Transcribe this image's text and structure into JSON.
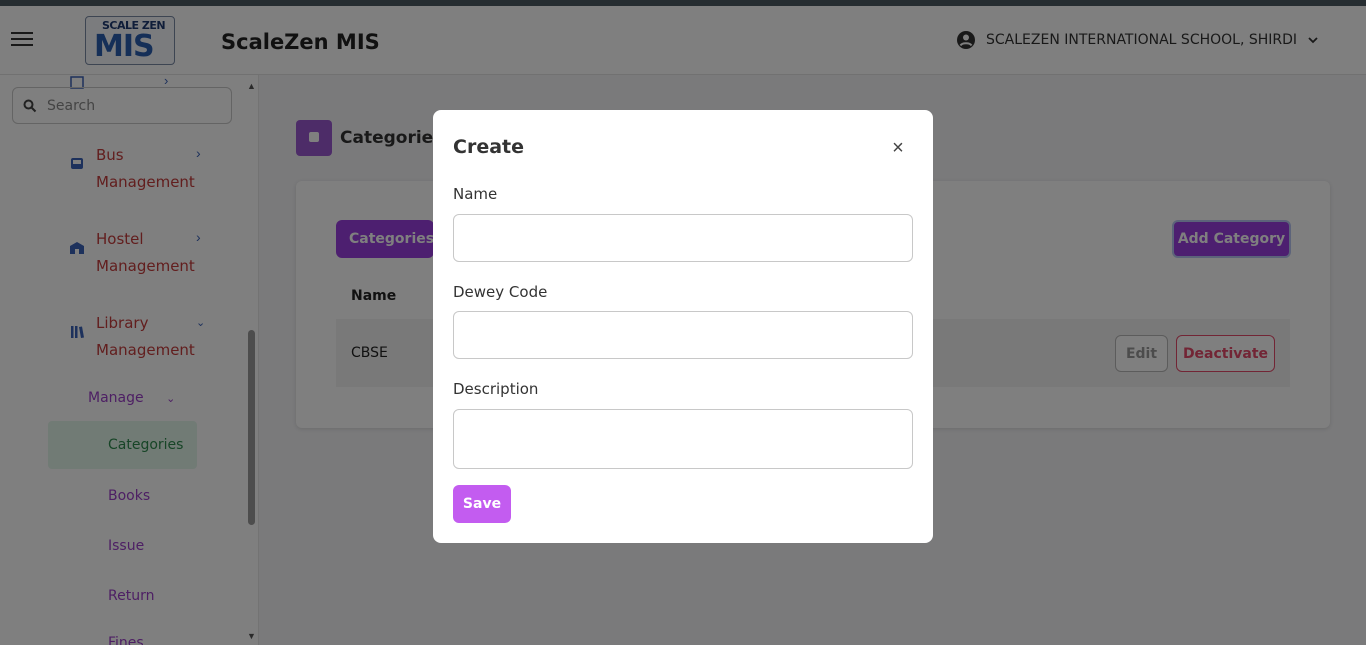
{
  "header": {
    "app_title": "ScaleZen MIS",
    "logo_top_text": "SCALE ZEN",
    "logo_main_text": "MIS",
    "school_name": "SCALEZEN INTERNATIONAL SCHOOL, SHIRDI"
  },
  "sidebar": {
    "search_placeholder": "Search",
    "items": [
      {
        "label": "Bus Management",
        "icon": "bus-icon"
      },
      {
        "label": "Hostel Management",
        "icon": "hostel-icon"
      },
      {
        "label": "Library Management",
        "icon": "library-icon"
      }
    ],
    "manage_label": "Manage",
    "sub_items": [
      "Categories",
      "Books",
      "Issue",
      "Return",
      "Fines"
    ],
    "active_sub_item": "Categories"
  },
  "main": {
    "page_title": "Categories",
    "tab_label": "Categories",
    "add_button": "Add Category",
    "table": {
      "headers": [
        "Name"
      ],
      "rows": [
        {
          "name": "CBSE",
          "edit": "Edit",
          "deactivate": "Deactivate"
        }
      ]
    }
  },
  "modal": {
    "title": "Create",
    "fields": [
      {
        "label": "Name",
        "value": ""
      },
      {
        "label": "Dewey Code",
        "value": ""
      },
      {
        "label": "Description",
        "value": ""
      }
    ],
    "save_label": "Save"
  },
  "colors": {
    "accent": "#9b3fe0",
    "save": "#c35cf0",
    "danger": "#e54b6a",
    "nav_text": "#c43c3c",
    "sub_text": "#9b3fc8",
    "active_sub_text": "#2f8a4e"
  }
}
